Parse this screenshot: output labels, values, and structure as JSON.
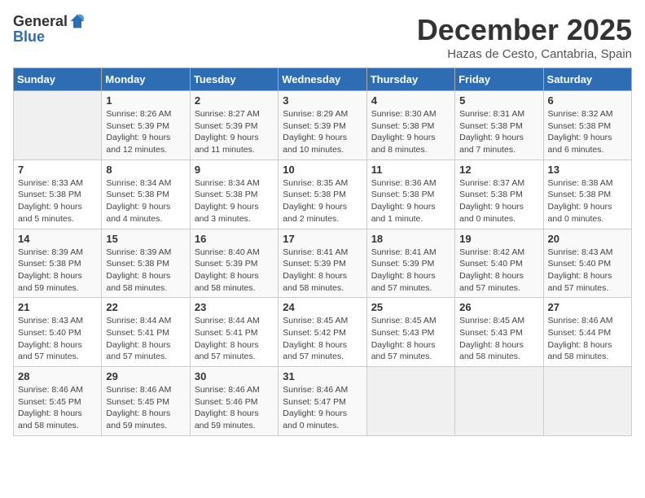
{
  "logo": {
    "general": "General",
    "blue": "Blue"
  },
  "title": "December 2025",
  "location": "Hazas de Cesto, Cantabria, Spain",
  "days_of_week": [
    "Sunday",
    "Monday",
    "Tuesday",
    "Wednesday",
    "Thursday",
    "Friday",
    "Saturday"
  ],
  "weeks": [
    [
      {
        "day": "",
        "sunrise": "",
        "sunset": "",
        "daylight": ""
      },
      {
        "day": "1",
        "sunrise": "Sunrise: 8:26 AM",
        "sunset": "Sunset: 5:39 PM",
        "daylight": "Daylight: 9 hours and 12 minutes."
      },
      {
        "day": "2",
        "sunrise": "Sunrise: 8:27 AM",
        "sunset": "Sunset: 5:39 PM",
        "daylight": "Daylight: 9 hours and 11 minutes."
      },
      {
        "day": "3",
        "sunrise": "Sunrise: 8:29 AM",
        "sunset": "Sunset: 5:39 PM",
        "daylight": "Daylight: 9 hours and 10 minutes."
      },
      {
        "day": "4",
        "sunrise": "Sunrise: 8:30 AM",
        "sunset": "Sunset: 5:38 PM",
        "daylight": "Daylight: 9 hours and 8 minutes."
      },
      {
        "day": "5",
        "sunrise": "Sunrise: 8:31 AM",
        "sunset": "Sunset: 5:38 PM",
        "daylight": "Daylight: 9 hours and 7 minutes."
      },
      {
        "day": "6",
        "sunrise": "Sunrise: 8:32 AM",
        "sunset": "Sunset: 5:38 PM",
        "daylight": "Daylight: 9 hours and 6 minutes."
      }
    ],
    [
      {
        "day": "7",
        "sunrise": "Sunrise: 8:33 AM",
        "sunset": "Sunset: 5:38 PM",
        "daylight": "Daylight: 9 hours and 5 minutes."
      },
      {
        "day": "8",
        "sunrise": "Sunrise: 8:34 AM",
        "sunset": "Sunset: 5:38 PM",
        "daylight": "Daylight: 9 hours and 4 minutes."
      },
      {
        "day": "9",
        "sunrise": "Sunrise: 8:34 AM",
        "sunset": "Sunset: 5:38 PM",
        "daylight": "Daylight: 9 hours and 3 minutes."
      },
      {
        "day": "10",
        "sunrise": "Sunrise: 8:35 AM",
        "sunset": "Sunset: 5:38 PM",
        "daylight": "Daylight: 9 hours and 2 minutes."
      },
      {
        "day": "11",
        "sunrise": "Sunrise: 8:36 AM",
        "sunset": "Sunset: 5:38 PM",
        "daylight": "Daylight: 9 hours and 1 minute."
      },
      {
        "day": "12",
        "sunrise": "Sunrise: 8:37 AM",
        "sunset": "Sunset: 5:38 PM",
        "daylight": "Daylight: 9 hours and 0 minutes."
      },
      {
        "day": "13",
        "sunrise": "Sunrise: 8:38 AM",
        "sunset": "Sunset: 5:38 PM",
        "daylight": "Daylight: 9 hours and 0 minutes."
      }
    ],
    [
      {
        "day": "14",
        "sunrise": "Sunrise: 8:39 AM",
        "sunset": "Sunset: 5:38 PM",
        "daylight": "Daylight: 8 hours and 59 minutes."
      },
      {
        "day": "15",
        "sunrise": "Sunrise: 8:39 AM",
        "sunset": "Sunset: 5:38 PM",
        "daylight": "Daylight: 8 hours and 58 minutes."
      },
      {
        "day": "16",
        "sunrise": "Sunrise: 8:40 AM",
        "sunset": "Sunset: 5:39 PM",
        "daylight": "Daylight: 8 hours and 58 minutes."
      },
      {
        "day": "17",
        "sunrise": "Sunrise: 8:41 AM",
        "sunset": "Sunset: 5:39 PM",
        "daylight": "Daylight: 8 hours and 58 minutes."
      },
      {
        "day": "18",
        "sunrise": "Sunrise: 8:41 AM",
        "sunset": "Sunset: 5:39 PM",
        "daylight": "Daylight: 8 hours and 57 minutes."
      },
      {
        "day": "19",
        "sunrise": "Sunrise: 8:42 AM",
        "sunset": "Sunset: 5:40 PM",
        "daylight": "Daylight: 8 hours and 57 minutes."
      },
      {
        "day": "20",
        "sunrise": "Sunrise: 8:43 AM",
        "sunset": "Sunset: 5:40 PM",
        "daylight": "Daylight: 8 hours and 57 minutes."
      }
    ],
    [
      {
        "day": "21",
        "sunrise": "Sunrise: 8:43 AM",
        "sunset": "Sunset: 5:40 PM",
        "daylight": "Daylight: 8 hours and 57 minutes."
      },
      {
        "day": "22",
        "sunrise": "Sunrise: 8:44 AM",
        "sunset": "Sunset: 5:41 PM",
        "daylight": "Daylight: 8 hours and 57 minutes."
      },
      {
        "day": "23",
        "sunrise": "Sunrise: 8:44 AM",
        "sunset": "Sunset: 5:41 PM",
        "daylight": "Daylight: 8 hours and 57 minutes."
      },
      {
        "day": "24",
        "sunrise": "Sunrise: 8:45 AM",
        "sunset": "Sunset: 5:42 PM",
        "daylight": "Daylight: 8 hours and 57 minutes."
      },
      {
        "day": "25",
        "sunrise": "Sunrise: 8:45 AM",
        "sunset": "Sunset: 5:43 PM",
        "daylight": "Daylight: 8 hours and 57 minutes."
      },
      {
        "day": "26",
        "sunrise": "Sunrise: 8:45 AM",
        "sunset": "Sunset: 5:43 PM",
        "daylight": "Daylight: 8 hours and 58 minutes."
      },
      {
        "day": "27",
        "sunrise": "Sunrise: 8:46 AM",
        "sunset": "Sunset: 5:44 PM",
        "daylight": "Daylight: 8 hours and 58 minutes."
      }
    ],
    [
      {
        "day": "28",
        "sunrise": "Sunrise: 8:46 AM",
        "sunset": "Sunset: 5:45 PM",
        "daylight": "Daylight: 8 hours and 58 minutes."
      },
      {
        "day": "29",
        "sunrise": "Sunrise: 8:46 AM",
        "sunset": "Sunset: 5:45 PM",
        "daylight": "Daylight: 8 hours and 59 minutes."
      },
      {
        "day": "30",
        "sunrise": "Sunrise: 8:46 AM",
        "sunset": "Sunset: 5:46 PM",
        "daylight": "Daylight: 8 hours and 59 minutes."
      },
      {
        "day": "31",
        "sunrise": "Sunrise: 8:46 AM",
        "sunset": "Sunset: 5:47 PM",
        "daylight": "Daylight: 9 hours and 0 minutes."
      },
      {
        "day": "",
        "sunrise": "",
        "sunset": "",
        "daylight": ""
      },
      {
        "day": "",
        "sunrise": "",
        "sunset": "",
        "daylight": ""
      },
      {
        "day": "",
        "sunrise": "",
        "sunset": "",
        "daylight": ""
      }
    ]
  ]
}
